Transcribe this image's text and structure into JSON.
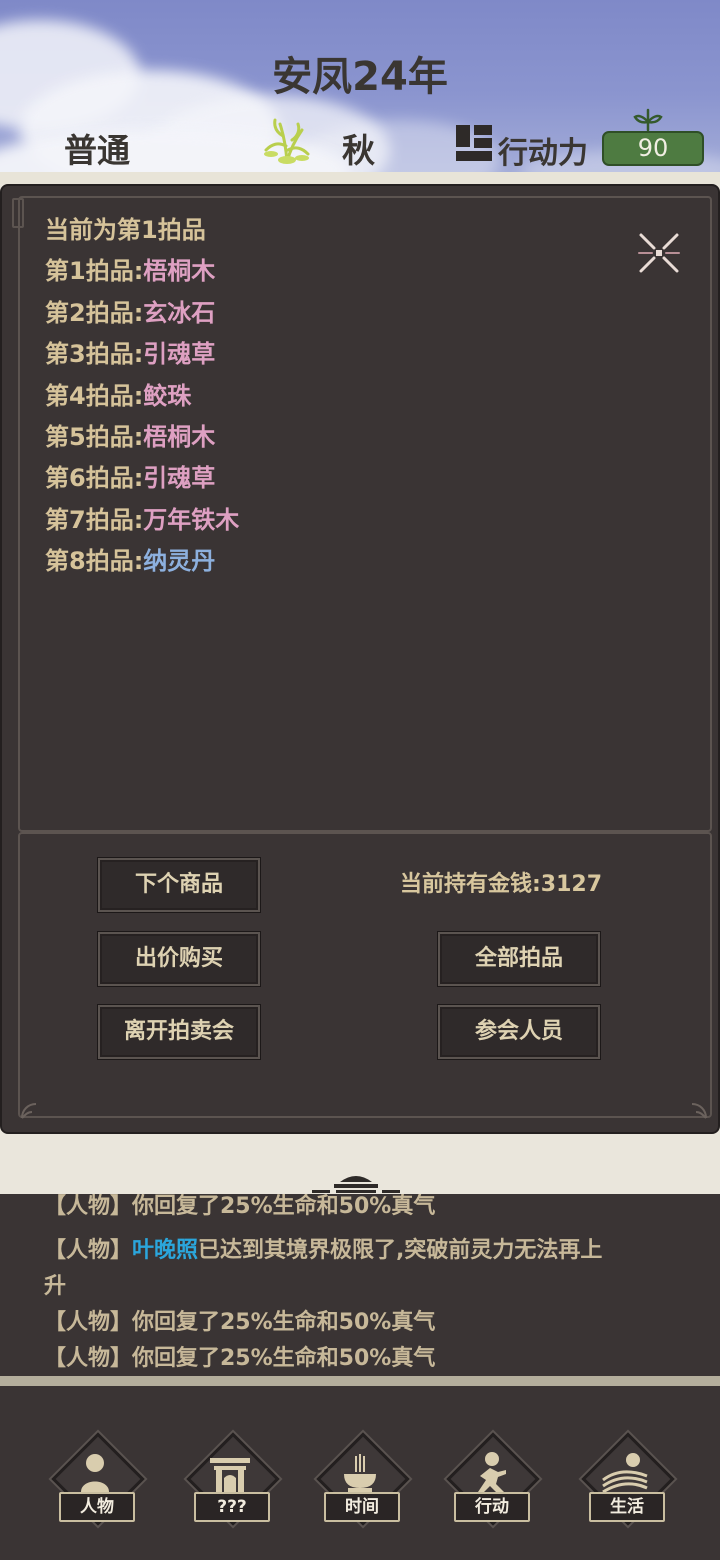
{
  "header": {
    "title": "安凤24年",
    "difficulty": "普通",
    "season": "秋",
    "action_points_label": "行动力",
    "action_points_value": "90"
  },
  "auction": {
    "current": "当前为第1拍品",
    "items": [
      {
        "prefix": "第1拍品:",
        "name": "梧桐木",
        "color": "#dea0c2"
      },
      {
        "prefix": "第2拍品:",
        "name": "玄冰石",
        "color": "#dea0c2"
      },
      {
        "prefix": "第3拍品:",
        "name": "引魂草",
        "color": "#dea0c2"
      },
      {
        "prefix": "第4拍品:",
        "name": "鲛珠",
        "color": "#dea0c2"
      },
      {
        "prefix": "第5拍品:",
        "name": "梧桐木",
        "color": "#dea0c2"
      },
      {
        "prefix": "第6拍品:",
        "name": "引魂草",
        "color": "#dea0c2"
      },
      {
        "prefix": "第7拍品:",
        "name": "万年铁木",
        "color": "#dea0c2"
      },
      {
        "prefix": "第8拍品:",
        "name": "纳灵丹",
        "color": "#8db0de"
      }
    ],
    "money_label": "当前持有金钱:3127",
    "buttons": {
      "next": "下个商品",
      "bid": "出价购买",
      "leave": "离开拍卖会",
      "all_items": "全部拍品",
      "attendees": "参会人员"
    }
  },
  "log": {
    "partial": "【人物】你回复了25%生命和50%真气",
    "line1_tag": "【人物】",
    "line1_name": "叶晚照",
    "line1_text": "已达到其境界极限了,突破前灵力无法再上",
    "line1_wrap": "升",
    "line2": "【人物】你回复了25%生命和50%真气",
    "line3": "【人物】你回复了25%生命和50%真气"
  },
  "nav": {
    "character": "人物",
    "unknown": "???",
    "time": "时间",
    "action": "行动",
    "life": "生活"
  }
}
